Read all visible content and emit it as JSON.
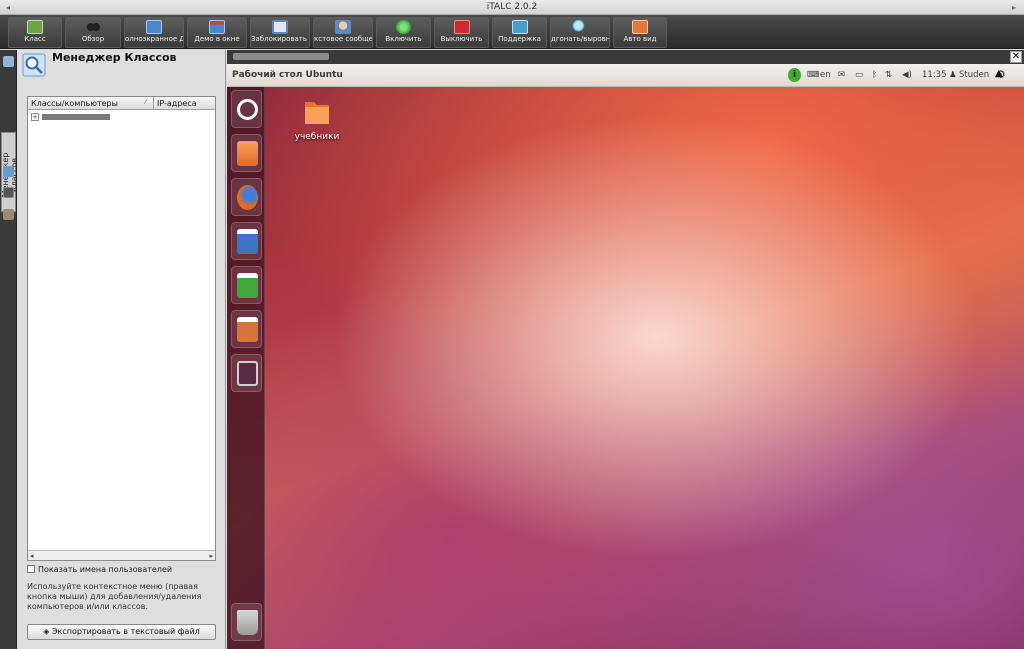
{
  "window": {
    "title": "iTALC 2.0.2"
  },
  "toolbar": {
    "buttons": [
      {
        "label": "Класс",
        "icon": "classroom-icon",
        "color": "#6fa34a"
      },
      {
        "label": "Обзор",
        "icon": "overview-icon",
        "color": "#777777"
      },
      {
        "label": "олноэкранное Дем",
        "icon": "fullscreen-demo-icon",
        "color": "#4a86c8"
      },
      {
        "label": "Демо в окне",
        "icon": "window-demo-icon",
        "color": "#4a86c8"
      },
      {
        "label": "Заблокировать вс",
        "icon": "lock-icon",
        "color": "#5b8bc0"
      },
      {
        "label": "кстовое сообщени",
        "icon": "message-icon",
        "color": "#5b8bc0"
      },
      {
        "label": "Включить",
        "icon": "power-on-icon",
        "color": "#2fa82f"
      },
      {
        "label": "Выключить",
        "icon": "power-off-icon",
        "color": "#cc2b2b"
      },
      {
        "label": "Поддержка",
        "icon": "support-icon",
        "color": "#4aa0c8"
      },
      {
        "label": "дгонать/выровня",
        "icon": "align-icon",
        "color": "#4aa0c8"
      },
      {
        "label": "Авто вид",
        "icon": "auto-view-icon",
        "color": "#e27a3f"
      }
    ]
  },
  "sidebar": {
    "tab_label": "Менеджер Классов"
  },
  "class_manager": {
    "title": "Менеджер Классов",
    "columns": [
      "Классы/компьютеры",
      "IP-адреса"
    ],
    "show_users_label": "Показать имена пользователей",
    "hint": "Используйте контекстное меню (правая кнопка мыши) для добавления/удаления компьютеров и/или классов.",
    "export_label": "Экспортировать в текстовый файл"
  },
  "remote": {
    "panel_title": "Рабочий стол Ubuntu",
    "keyboard_layout": "en",
    "time": "11:35",
    "user": "Studen",
    "desktop_folder": "учебники"
  },
  "colors": {
    "ubuntu_orange": "#e95420",
    "launcher": "#46142a"
  }
}
